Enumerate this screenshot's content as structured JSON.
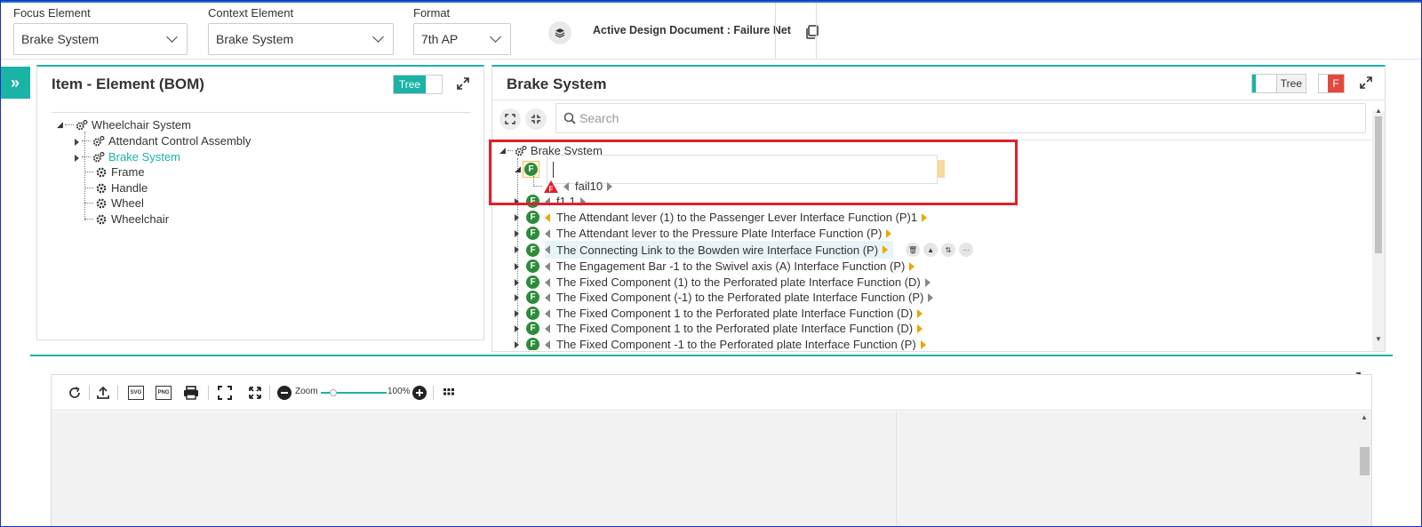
{
  "topbar": {
    "focus_label": "Focus Element",
    "focus_value": "Brake System",
    "context_label": "Context Element",
    "context_value": "Brake System",
    "format_label": "Format",
    "format_value": "7th AP",
    "active_doc": "Active Design Document : Failure Net"
  },
  "left_panel": {
    "title": "Item - Element (BOM)",
    "toggle_label": "Tree",
    "tree": {
      "root": "Wheelchair System",
      "children": [
        "Attendant Control Assembly",
        "Brake System",
        "Frame",
        "Handle",
        "Wheel",
        "Wheelchair"
      ]
    }
  },
  "right_panel": {
    "title": "Brake System",
    "toggle_label": "Tree",
    "f_badge": "F",
    "search_placeholder": "Search",
    "tree_root": "Brake System",
    "edit_value": "",
    "failure_item": "fail10",
    "f_label": "F",
    "f1": "f1.1",
    "functions": [
      "The Attendant lever (1) to the Passenger Lever Interface Function (P)1",
      "The Attendant lever to the Pressure Plate Interface Function (P)",
      "The Connecting Link to the Bowden wire Interface Function (P)",
      "The Engagement Bar -1 to the Swivel axis (A) Interface Function (P)",
      "The Fixed Component (1) to the Perforated plate Interface Function (D)",
      "The Fixed Component (-1) to the Perforated plate Interface Function (P)",
      "The Fixed Component 1 to the Perforated plate Interface Function (D)",
      "The Fixed Component 1 to the Perforated plate Interface Function (D)",
      "The Fixed Component -1 to the Perforated plate Interface Function (P)"
    ]
  },
  "viewer": {
    "zoom_label": "Zoom",
    "zoom_value": "100%",
    "svg_label": "SVG",
    "png_label": "PNG"
  },
  "colors": {
    "accent": "#1ab3a6",
    "function_green": "#2e8b3a",
    "failure_red": "#e0202a",
    "arrow_orange": "#f0a500"
  }
}
